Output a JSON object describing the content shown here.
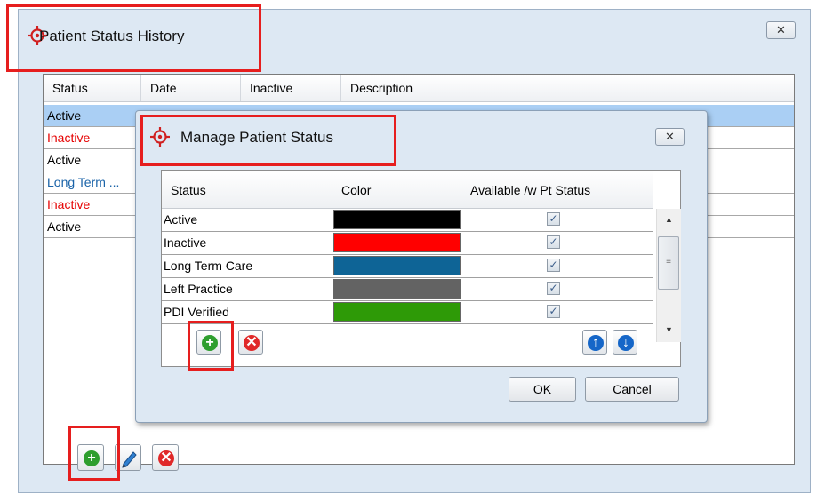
{
  "outer": {
    "title": "Patient Status History",
    "close_label": "✕",
    "columns": [
      "Status",
      "Date",
      "Inactive",
      "Description"
    ],
    "rows": [
      {
        "status": "Active",
        "color": "#000000"
      },
      {
        "status": "Inactive",
        "color": "#e60000"
      },
      {
        "status": "Active",
        "color": "#000000"
      },
      {
        "status": "Long Term ...",
        "color": "#1a63a8"
      },
      {
        "status": "Inactive",
        "color": "#e60000"
      },
      {
        "status": "Active",
        "color": "#000000"
      }
    ],
    "toolbar": {
      "add_icon": "plus-icon",
      "edit_icon": "pencil-icon",
      "delete_icon": "x-icon"
    }
  },
  "dialog": {
    "title": "Manage Patient Status",
    "close_label": "✕",
    "columns": [
      "Status",
      "Color",
      "Available /w Pt Status"
    ],
    "rows": [
      {
        "name": "Active",
        "color": "#000000",
        "available": true
      },
      {
        "name": "Inactive",
        "color": "#ff0000",
        "available": true
      },
      {
        "name": "Long Term Care",
        "color": "#0e6496",
        "available": true
      },
      {
        "name": "Left Practice",
        "color": "#636363",
        "available": true
      },
      {
        "name": "PDI Verified",
        "color": "#2e9a07",
        "available": true
      }
    ],
    "ok_label": "OK",
    "cancel_label": "Cancel"
  },
  "colors": {
    "highlight_box": "#e61e1e",
    "selected_row": "#aacff4",
    "window_bg": "#dde8f3"
  }
}
